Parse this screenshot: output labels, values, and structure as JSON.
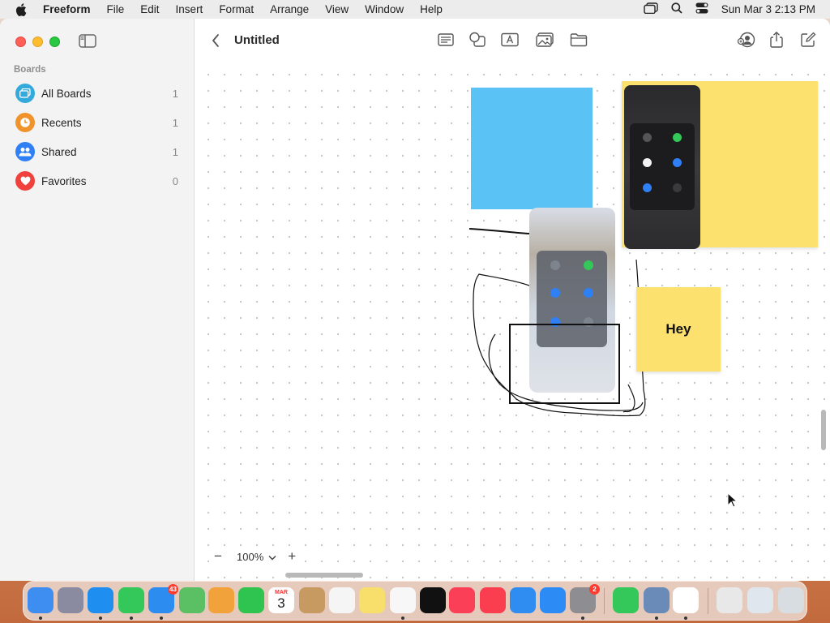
{
  "menubar": {
    "app_name": "Freeform",
    "items": [
      "File",
      "Edit",
      "Insert",
      "Format",
      "Arrange",
      "View",
      "Window",
      "Help"
    ],
    "clock": "Sun Mar 3  2:13 PM"
  },
  "sidebar": {
    "section_label": "Boards",
    "items": [
      {
        "label": "All Boards",
        "count": "1",
        "icon": "boards-icon",
        "color": "#34aadc"
      },
      {
        "label": "Recents",
        "count": "1",
        "icon": "clock-icon",
        "color": "#f0932b"
      },
      {
        "label": "Shared",
        "count": "1",
        "icon": "people-icon",
        "color": "#2f7ff5"
      },
      {
        "label": "Favorites",
        "count": "0",
        "icon": "heart-icon",
        "color": "#f0413c"
      }
    ]
  },
  "toolbar": {
    "title": "Untitled",
    "tools": [
      "sticky-note-icon",
      "shapes-icon",
      "text-box-icon",
      "media-icon",
      "folder-icon",
      "collaborate-icon",
      "share-icon",
      "new-board-icon"
    ]
  },
  "canvas": {
    "sticky_note_text": "Hey",
    "colors": {
      "blue_shape": "#5bc2f5",
      "yellow_sticky": "#fde16f"
    }
  },
  "zoom": {
    "value": "100%",
    "minus": "−",
    "plus": "+"
  },
  "dock": {
    "apps": [
      {
        "name": "finder-icon",
        "color": "#3d8ef0"
      },
      {
        "name": "launchpad-icon",
        "color": "#8a8aa0"
      },
      {
        "name": "safari-icon",
        "color": "#1e8ef0"
      },
      {
        "name": "messages-icon",
        "color": "#34c759"
      },
      {
        "name": "mail-icon",
        "color": "#2d8cf0",
        "badge": "43"
      },
      {
        "name": "maps-icon",
        "color": "#5bbf64"
      },
      {
        "name": "photos-icon",
        "color": "#f2a23a"
      },
      {
        "name": "facetime-icon",
        "color": "#2fc44f"
      },
      {
        "name": "calendar-icon",
        "color": "#ffffff",
        "month": "MAR",
        "day": "3"
      },
      {
        "name": "contacts-icon",
        "color": "#c79a62"
      },
      {
        "name": "reminders-icon",
        "color": "#f5f5f5"
      },
      {
        "name": "notes-icon",
        "color": "#f8df6c"
      },
      {
        "name": "freeform-icon",
        "color": "#f7f7f7"
      },
      {
        "name": "apple-tv-icon",
        "color": "#111111"
      },
      {
        "name": "music-icon",
        "color": "#fb3f57"
      },
      {
        "name": "news-icon",
        "color": "#fa3e50"
      },
      {
        "name": "keynote-icon",
        "color": "#2f8cf0"
      },
      {
        "name": "app-store-icon",
        "color": "#2c8bf5"
      },
      {
        "name": "system-settings-icon",
        "color": "#8d8d92",
        "badge": "2"
      },
      {
        "name": "find-my-icon",
        "color": "#34c759"
      },
      {
        "name": "preview-icon",
        "color": "#6a8bb8"
      },
      {
        "name": "chrome-icon",
        "color": "#ffffff"
      },
      {
        "name": "document-icon",
        "color": "#e8e8e8"
      },
      {
        "name": "screenshot-folder-icon",
        "color": "#dfe6ee"
      },
      {
        "name": "trash-icon",
        "color": "#d8dde2"
      }
    ]
  }
}
